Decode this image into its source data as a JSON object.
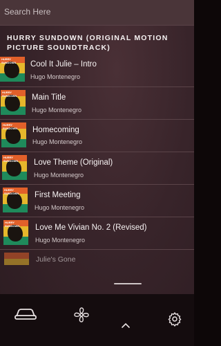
{
  "search": {
    "placeholder": "Search Here"
  },
  "album": {
    "title": "HURRY SUNDOWN (ORIGINAL MOTION PICTURE SOUNDTRACK)"
  },
  "tracks": [
    {
      "name": "Cool It Julie – Intro",
      "artist": "Hugo Montenegro",
      "art_text": "HURRY SUNDOWN"
    },
    {
      "name": "Main Title",
      "artist": "Hugo Montenegro",
      "art_text": "HURRY SUNDOWN"
    },
    {
      "name": "Homecoming",
      "artist": "Hugo Montenegro",
      "art_text": "HURRY SUNDOWN"
    },
    {
      "name": "Love Theme (Original)",
      "artist": "Hugo Montenegro",
      "art_text": "HURRY SUNDOWN"
    },
    {
      "name": "First Meeting",
      "artist": "Hugo Montenegro",
      "art_text": "HURRY SUNDOWN"
    },
    {
      "name": "Love Me Vivian No. 2 (Revised)",
      "artist": "Hugo Montenegro",
      "art_text": "HURRY SUNDOWN"
    },
    {
      "name": "Julie's Gone",
      "artist": "",
      "art_text": ""
    }
  ],
  "bottom_nav": {
    "icons": [
      "car-icon",
      "fan-icon",
      "chevron-up-icon",
      "gear-icon"
    ]
  },
  "colors": {
    "background": "#38242a",
    "search_bar": "#4a3539",
    "bottom_bar": "#140c0e",
    "art_orange": "#e2602a",
    "art_yellow": "#e6b72c",
    "art_green": "#1f8a5b"
  }
}
